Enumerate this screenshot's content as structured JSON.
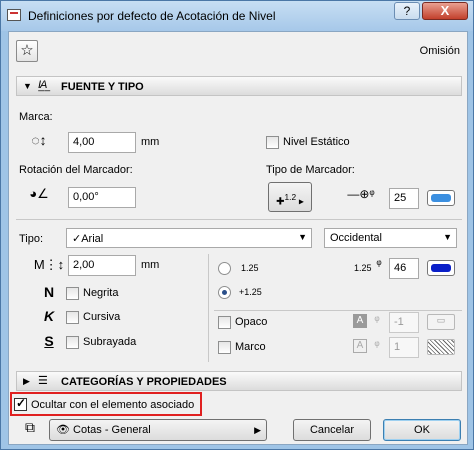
{
  "window": {
    "title": "Definiciones por defecto de Acotación de Nivel",
    "help_label": "?",
    "close_label": "X"
  },
  "header": {
    "favorites_icon": "star-icon",
    "omision": "Omisión"
  },
  "fuente_tipo": {
    "section_label": "FUENTE Y TIPO",
    "marca_label": "Marca:",
    "marca_value": "4,00",
    "marca_unit": "mm",
    "nivel_estatico_label": "Nivel Estático",
    "nivel_estatico_checked": false,
    "rotacion_label": "Rotación del Marcador:",
    "rotacion_value": "0,00°",
    "tipo_marcador_label": "Tipo de Marcador:",
    "marker_type_value": "1.2",
    "marker_pen_value": "25",
    "tipo_label": "Tipo:",
    "font_name": "✓Arial",
    "script_name": "Occidental",
    "text_size_value": "2,00",
    "text_size_unit": "mm",
    "negrita_label": "Negrita",
    "cursiva_label": "Cursiva",
    "subrayada_label": "Subrayada",
    "bold_glyph": "N",
    "italic_glyph": "K",
    "underline_glyph": "S",
    "radio1_label": "1.25",
    "radio2_label": "+1.25",
    "radio_selected": 2,
    "text_pen_label": "1.25",
    "text_pen_value": "46",
    "opaco_label": "Opaco",
    "opaco_pen_value": "-1",
    "marco_label": "Marco",
    "marco_pen_value": "1"
  },
  "categorias": {
    "section_label": "CATEGORÍAS Y PROPIEDADES"
  },
  "footer": {
    "ocultar_label": "Ocultar con el elemento asociado",
    "ocultar_checked": true,
    "layer_value": "Cotas - General",
    "cancel_label": "Cancelar",
    "ok_label": "OK"
  },
  "colors": {
    "pen_blue": "#3b8fe0",
    "pen_navy": "#0a1fc8",
    "highlight": "#e02020"
  }
}
